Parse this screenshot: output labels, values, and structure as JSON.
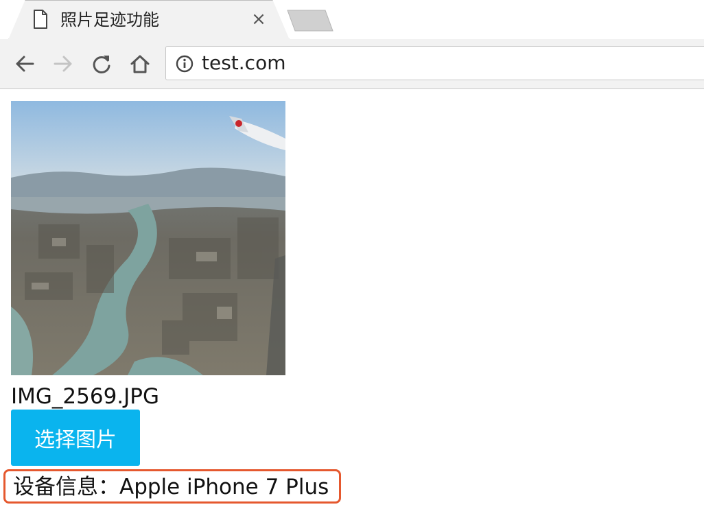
{
  "browser": {
    "tab_title": "照片足迹功能",
    "close_symbol": "×",
    "url": "test.com"
  },
  "page": {
    "photo_icon": "aerial-city-photo",
    "file_name": "IMG_2569.JPG",
    "select_button_label": "选择图片",
    "device_info": "设备信息：Apple iPhone 7 Plus"
  },
  "colors": {
    "button_bg": "#0ab4ee",
    "highlight_border": "#e5582e"
  }
}
